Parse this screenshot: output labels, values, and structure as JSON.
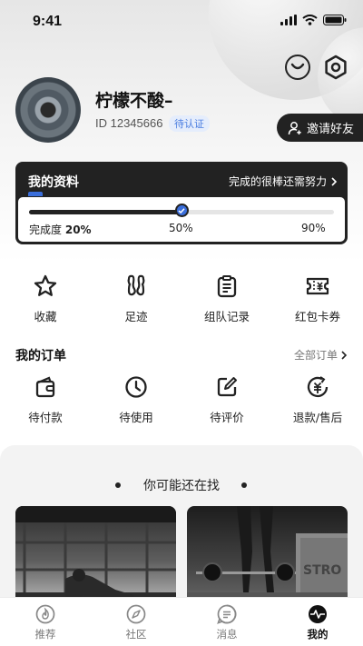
{
  "status_bar": {
    "time": "9:41"
  },
  "profile": {
    "name": "柠檬不酸–",
    "id_text": "ID 12345666",
    "verify_badge": "待认证",
    "invite_button": "邀请好友"
  },
  "info_card": {
    "title": "我的资料",
    "tip": "完成的很棒还需努力",
    "completion_label": "完成度",
    "completion_value": "20%",
    "mid_mark": "50%",
    "end_mark": "90%",
    "progress": 0.5
  },
  "quick_menu": [
    {
      "label": "收藏",
      "icon": "star-icon"
    },
    {
      "label": "足迹",
      "icon": "footprint-icon"
    },
    {
      "label": "组队记录",
      "icon": "clipboard-icon"
    },
    {
      "label": "红包卡券",
      "icon": "coupon-icon"
    }
  ],
  "orders": {
    "title": "我的订单",
    "more": "全部订单",
    "items": [
      {
        "label": "待付款",
        "icon": "wallet-icon"
      },
      {
        "label": "待使用",
        "icon": "clock-icon"
      },
      {
        "label": "待评价",
        "icon": "edit-icon"
      },
      {
        "label": "退款/售后",
        "icon": "refund-icon"
      }
    ]
  },
  "recommend": {
    "title": "你可能还在找"
  },
  "tab_bar": [
    {
      "label": "推荐",
      "icon": "fire-icon",
      "active": false
    },
    {
      "label": "社区",
      "icon": "compass-icon",
      "active": false
    },
    {
      "label": "消息",
      "icon": "message-icon",
      "active": false
    },
    {
      "label": "我的",
      "icon": "profile-pulse-icon",
      "active": true
    }
  ],
  "colors": {
    "accent": "#3a6edb",
    "dark": "#222222"
  }
}
